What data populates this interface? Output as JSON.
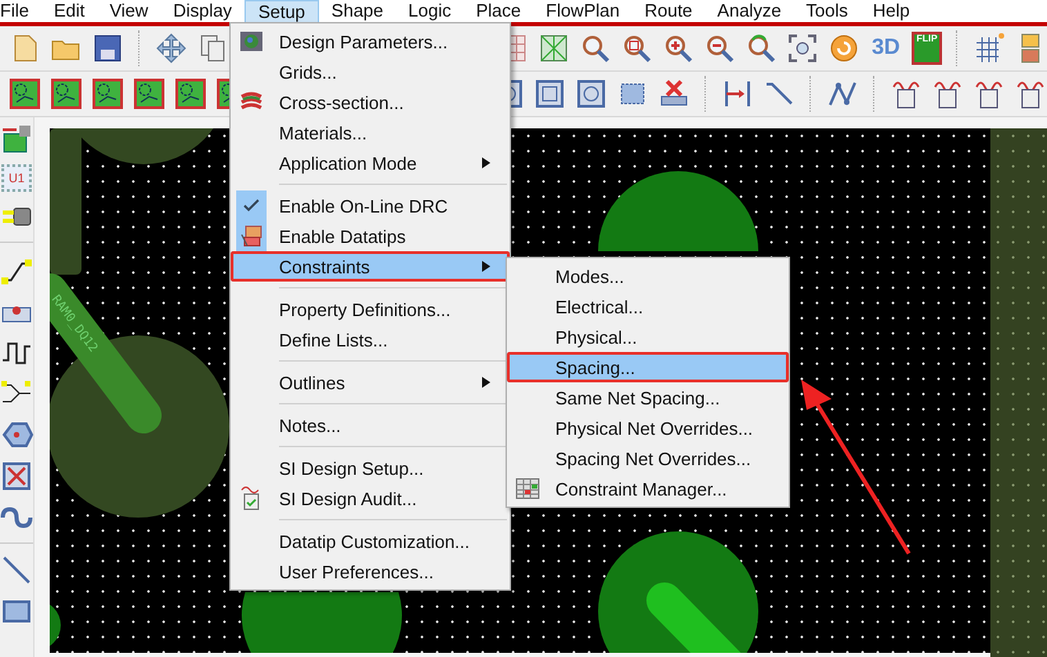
{
  "menu_bar": [
    {
      "label": "File",
      "selected": false
    },
    {
      "label": "Edit",
      "selected": false
    },
    {
      "label": "View",
      "selected": false
    },
    {
      "label": "Display",
      "selected": false
    },
    {
      "label": "Setup",
      "selected": true
    },
    {
      "label": "Shape",
      "selected": false
    },
    {
      "label": "Logic",
      "selected": false
    },
    {
      "label": "Place",
      "selected": false
    },
    {
      "label": "FlowPlan",
      "selected": false
    },
    {
      "label": "Route",
      "selected": false
    },
    {
      "label": "Analyze",
      "selected": false
    },
    {
      "label": "Tools",
      "selected": false
    },
    {
      "label": "Help",
      "selected": false
    }
  ],
  "toolbar": {
    "view_3d_label": "3D",
    "flip_label": "FLIP"
  },
  "left_toolbar": {
    "chip_label": "U1"
  },
  "board": {
    "net_label": "RAM0_DQ12"
  },
  "setup_menu": [
    {
      "kind": "item",
      "label": "Design Parameters...",
      "checked": false,
      "submenu": false,
      "selected": false
    },
    {
      "kind": "item",
      "label": "Grids...",
      "checked": false,
      "submenu": false,
      "selected": false
    },
    {
      "kind": "item",
      "label": "Cross-section...",
      "checked": false,
      "submenu": false,
      "selected": false
    },
    {
      "kind": "item",
      "label": "Materials...",
      "checked": false,
      "submenu": false,
      "selected": false
    },
    {
      "kind": "item",
      "label": "Application Mode",
      "checked": false,
      "submenu": true,
      "selected": false
    },
    {
      "kind": "separator"
    },
    {
      "kind": "item",
      "label": "Enable On-Line DRC",
      "checked": true,
      "submenu": false,
      "selected": false
    },
    {
      "kind": "item",
      "label": "Enable Datatips",
      "checked": true,
      "submenu": false,
      "selected": false
    },
    {
      "kind": "item",
      "label": "Constraints",
      "checked": false,
      "submenu": true,
      "selected": true
    },
    {
      "kind": "separator"
    },
    {
      "kind": "item",
      "label": "Property Definitions...",
      "checked": false,
      "submenu": false,
      "selected": false
    },
    {
      "kind": "item",
      "label": "Define Lists...",
      "checked": false,
      "submenu": false,
      "selected": false
    },
    {
      "kind": "separator"
    },
    {
      "kind": "item",
      "label": "Outlines",
      "checked": false,
      "submenu": true,
      "selected": false
    },
    {
      "kind": "separator"
    },
    {
      "kind": "item",
      "label": "Notes...",
      "checked": false,
      "submenu": false,
      "selected": false
    },
    {
      "kind": "separator"
    },
    {
      "kind": "item",
      "label": "SI Design Setup...",
      "checked": false,
      "submenu": false,
      "selected": false
    },
    {
      "kind": "item",
      "label": "SI Design Audit...",
      "checked": false,
      "submenu": false,
      "selected": false
    },
    {
      "kind": "separator"
    },
    {
      "kind": "item",
      "label": "Datatip Customization...",
      "checked": false,
      "submenu": false,
      "selected": false
    },
    {
      "kind": "item",
      "label": "User Preferences...",
      "checked": false,
      "submenu": false,
      "selected": false
    }
  ],
  "constraints_submenu": [
    {
      "label": "Modes...",
      "selected": false
    },
    {
      "label": "Electrical...",
      "selected": false
    },
    {
      "label": "Physical...",
      "selected": false
    },
    {
      "label": "Spacing...",
      "selected": true
    },
    {
      "label": "Same Net Spacing...",
      "selected": false
    },
    {
      "label": "Physical Net Overrides...",
      "selected": false
    },
    {
      "label": "Spacing Net Overrides...",
      "selected": false
    },
    {
      "label": "Constraint Manager...",
      "selected": false
    }
  ]
}
